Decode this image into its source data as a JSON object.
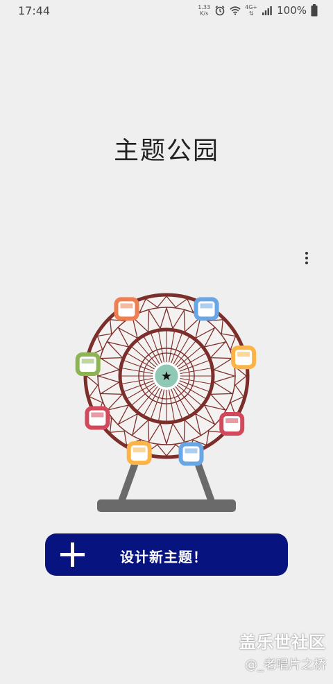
{
  "status_bar": {
    "time": "17:44",
    "net_speed_value": "1.33",
    "net_speed_unit": "K/s",
    "network_type": "4G+",
    "battery_percent": "100%"
  },
  "page": {
    "title": "主题公园"
  },
  "more_menu": {
    "icon": "more-vertical-icon"
  },
  "cta": {
    "label": "设计新主题！",
    "icon": "plus-icon",
    "color": "#07137f"
  },
  "watermark": {
    "brand": "盖乐世社区",
    "author": "@_老唱片之桥"
  },
  "colors": {
    "background": "#efefef",
    "wheel_rim": "#7c2e2a",
    "support": "#6a6a6a",
    "hub": "#8fc9b5",
    "cabin_orange": "#ef7f50",
    "cabin_blue": "#6aa6e4",
    "cabin_yellow": "#fdb447",
    "cabin_red": "#d1495b",
    "cabin_green": "#8cb452"
  }
}
